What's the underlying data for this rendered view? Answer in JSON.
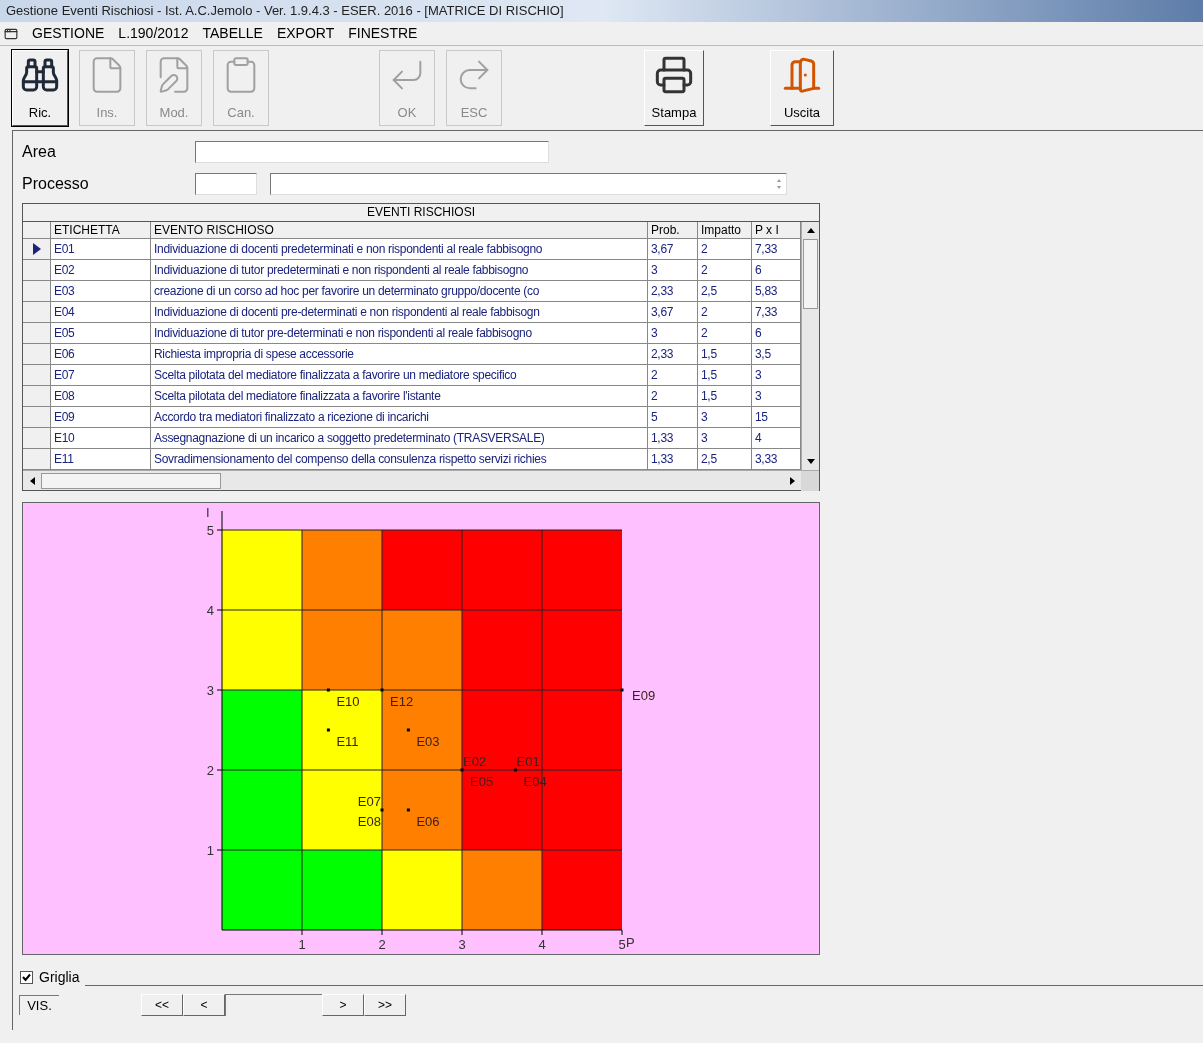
{
  "window": {
    "title": "Gestione Eventi Rischiosi - Ist. A.C.Jemolo - Ver. 1.9.4.3 - ESER. 2016 - [MATRICE DI RISCHIO]"
  },
  "menu": [
    "GESTIONE",
    "L.190/2012",
    "TABELLE",
    "EXPORT",
    "FINESTRE"
  ],
  "toolbar": [
    {
      "kind": "search",
      "label": "Ric.",
      "disabled": false
    },
    {
      "kind": "insert",
      "label": "Ins.",
      "disabled": true
    },
    {
      "kind": "edit",
      "label": "Mod.",
      "disabled": true
    },
    {
      "kind": "delete",
      "label": "Can.",
      "disabled": true
    },
    {
      "kind": "ok",
      "label": "OK",
      "disabled": true
    },
    {
      "kind": "esc",
      "label": "ESC",
      "disabled": true
    },
    {
      "kind": "print",
      "label": "Stampa",
      "disabled": false
    },
    {
      "kind": "exit",
      "label": "Uscita",
      "disabled": false
    }
  ],
  "form": {
    "area_label": "Area",
    "process_label": "Processo"
  },
  "table": {
    "title": "EVENTI RISCHIOSI",
    "columns": [
      "ETICHETTA",
      "EVENTO  RISCHIOSO",
      "Prob.",
      "Impatto",
      "P x I"
    ],
    "rows": [
      {
        "selected": true,
        "cells": [
          "E01",
          "Individuazione di docenti predeterminati e non rispondenti al reale fabbisogno",
          "3,67",
          "2",
          "7,33"
        ]
      },
      {
        "selected": false,
        "cells": [
          "E02",
          "Individuazione di tutor predeterminati e non rispondenti al reale fabbisogno",
          "3",
          "2",
          "6"
        ]
      },
      {
        "selected": false,
        "cells": [
          "E03",
          "creazione di un corso ad hoc per favorire un determinato gruppo/docente (co",
          "2,33",
          "2,5",
          "5,83"
        ]
      },
      {
        "selected": false,
        "cells": [
          "E04",
          "Individuazione di docenti  pre-determinati e non rispondenti al reale fabbisogn",
          "3,67",
          "2",
          "7,33"
        ]
      },
      {
        "selected": false,
        "cells": [
          "E05",
          "Individuazione di tutor pre-determinati e non rispondenti al reale fabbisogno",
          "3",
          "2",
          "6"
        ]
      },
      {
        "selected": false,
        "cells": [
          "E06",
          "Richiesta impropria di spese accessorie",
          "2,33",
          "1,5",
          "3,5"
        ]
      },
      {
        "selected": false,
        "cells": [
          "E07",
          "Scelta pilotata del mediatore finalizzata a favorire un mediatore specifico",
          "2",
          "1,5",
          "3"
        ]
      },
      {
        "selected": false,
        "cells": [
          "E08",
          "Scelta pilotata del mediatore finalizzata a favorire l'istante",
          "2",
          "1,5",
          "3"
        ]
      },
      {
        "selected": false,
        "cells": [
          "E09",
          "Accordo tra mediatori finalizzato a ricezione di incarichi",
          "5",
          "3",
          "15"
        ]
      },
      {
        "selected": false,
        "cells": [
          "E10",
          "Assegnagnazione di un incarico a soggetto predeterminato (TRASVERSALE)",
          "1,33",
          "3",
          "4"
        ]
      },
      {
        "selected": false,
        "cells": [
          "E11",
          "Sovradimensionamento del compenso della consulenza rispetto servizi richies",
          "1,33",
          "2,5",
          "3,33"
        ]
      }
    ]
  },
  "matrix": {
    "risk_zones": [
      {
        "cells": [
          {
            "color": "#ffff00"
          },
          {
            "color": "#ff8000"
          },
          {
            "color": "#ff0000"
          },
          {
            "color": "#ff0000"
          },
          {
            "color": "#ff0000"
          }
        ]
      },
      {
        "cells": [
          {
            "color": "#ffff00"
          },
          {
            "color": "#ff8000"
          },
          {
            "color": "#ff8000"
          },
          {
            "color": "#ff0000"
          },
          {
            "color": "#ff0000"
          }
        ]
      },
      {
        "cells": [
          {
            "color": "#00ff00"
          },
          {
            "color": "#ffff00"
          },
          {
            "color": "#ff8000"
          },
          {
            "color": "#ff0000"
          },
          {
            "color": "#ff0000"
          }
        ]
      },
      {
        "cells": [
          {
            "color": "#00ff00"
          },
          {
            "color": "#ffff00"
          },
          {
            "color": "#ff8000"
          },
          {
            "color": "#ff0000"
          },
          {
            "color": "#ff0000"
          }
        ]
      },
      {
        "cells": [
          {
            "color": "#00ff00"
          },
          {
            "color": "#00ff00"
          },
          {
            "color": "#ffff00"
          },
          {
            "color": "#ff8000"
          },
          {
            "color": "#ff0000"
          }
        ]
      }
    ],
    "chart_data": {
      "type": "scatter",
      "xlabel": "P",
      "ylabel": "I",
      "xlim": [
        0,
        5
      ],
      "ylim": [
        0,
        5
      ],
      "grid": true,
      "xticks": [
        {
          "value": 1,
          "label": "1"
        },
        {
          "value": 2,
          "label": "2"
        },
        {
          "value": 3,
          "label": "3"
        },
        {
          "value": 4,
          "label": "4"
        },
        {
          "value": 5,
          "label": "5"
        }
      ],
      "yticks": [
        {
          "value": 1,
          "label": "1"
        },
        {
          "value": 2,
          "label": "2"
        },
        {
          "value": 3,
          "label": "3"
        },
        {
          "value": 4,
          "label": "4"
        },
        {
          "value": 5,
          "label": "5"
        }
      ],
      "x": [
        3.67,
        3,
        2.33,
        2.33,
        2,
        5,
        1.33,
        1.33,
        2
      ],
      "series": [
        {
          "color": "#000000",
          "values": [
            2,
            2,
            2.5,
            1.5,
            1.5,
            3,
            3,
            2.5,
            3
          ]
        }
      ],
      "annotations": [
        {
          "x": 3.67,
          "y": 2,
          "text": "E01"
        },
        {
          "x": 3,
          "y": 2,
          "text": "E02"
        },
        {
          "x": 2.33,
          "y": 2.5,
          "text": "E03"
        },
        {
          "x": 3.67,
          "y": 2,
          "text": "E04"
        },
        {
          "x": 3,
          "y": 2,
          "text": "E05"
        },
        {
          "x": 2.33,
          "y": 1.5,
          "text": "E06"
        },
        {
          "x": 2,
          "y": 1.5,
          "text": "E07"
        },
        {
          "x": 2,
          "y": 1.5,
          "text": "E08"
        },
        {
          "x": 5,
          "y": 3,
          "text": "E09"
        },
        {
          "x": 1.33,
          "y": 3,
          "text": "E10"
        },
        {
          "x": 1.33,
          "y": 2.5,
          "text": "E11"
        },
        {
          "x": 2,
          "y": 3,
          "text": "E12"
        }
      ]
    }
  },
  "grid_option": {
    "label": "Griglia",
    "checked": true
  },
  "navigator": {
    "status": "VIS.",
    "buttons": [
      "<<",
      "<",
      ">",
      ">>"
    ]
  }
}
